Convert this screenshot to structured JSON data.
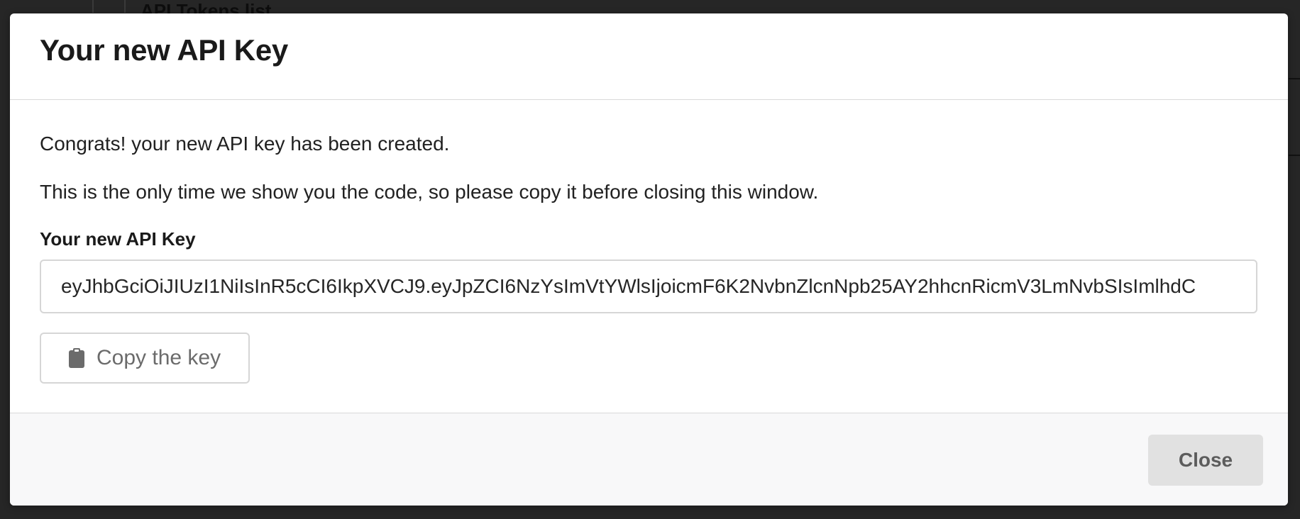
{
  "background": {
    "heading": "API Tokens list"
  },
  "modal": {
    "title": "Your new API Key",
    "message_1": "Congrats! your new API key has been created.",
    "message_2": "This is the only time we show you the code, so please copy it before closing this window.",
    "field_label": "Your new API Key",
    "api_key_value": "eyJhbGciOiJIUzI1NiIsInR5cCI6IkpXVCJ9.eyJpZCI6NzYsImVtYWlsIjoicmF6K2NvbnZlcnNpb25AY2hhcnRicmV3LmNvbSIsImlhdC",
    "copy_button_label": "Copy the key",
    "copy_icon": "clipboard-icon",
    "close_button_label": "Close"
  },
  "colors": {
    "overlay": "#1f1f1f",
    "modal_bg": "#ffffff",
    "footer_bg": "#f8f8f9",
    "close_button_bg": "#e1e1e1",
    "border": "#d6d6d6"
  }
}
